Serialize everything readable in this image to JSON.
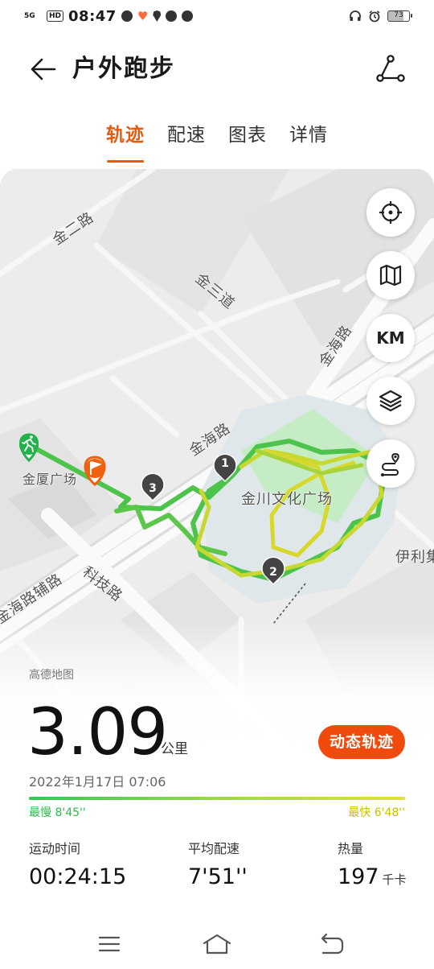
{
  "status_bar": {
    "network": "5G",
    "hd": "HD",
    "time": "08:47",
    "battery": "73"
  },
  "header": {
    "title": "户外跑步"
  },
  "tabs": [
    {
      "label": "轨迹",
      "active": true
    },
    {
      "label": "配速",
      "active": false
    },
    {
      "label": "图表",
      "active": false
    },
    {
      "label": "详情",
      "active": false
    }
  ],
  "map": {
    "roads": {
      "jin_er_road": "金二路",
      "jin_san_dao": "金三道",
      "jin_hai_road_ne": "金海路",
      "jin_hai_road": "金海路",
      "jin_hai_aux": "金海路辅路",
      "keji_road": "科技路",
      "yili": "伊利集"
    },
    "pois": {
      "park": "金川文化广场",
      "building": "金厦广场"
    },
    "markers": [
      "1",
      "2",
      "3"
    ],
    "controls": {
      "km_label": "KM"
    },
    "credit": "高德地图"
  },
  "summary": {
    "distance": "3.09",
    "distance_unit": "公里",
    "replay_label": "动态轨迹",
    "datetime": "2022年1月17日 07:06",
    "pace_slow": "最慢 8'45''",
    "pace_fast": "最快 6'48''"
  },
  "stats": [
    {
      "label": "运动时间",
      "value": "00:24:15",
      "unit": ""
    },
    {
      "label": "平均配速",
      "value": "7'51''",
      "unit": ""
    },
    {
      "label": "热量",
      "value": "197",
      "unit": "千卡"
    }
  ],
  "colors": {
    "accent": "#e8590c",
    "replay_button": "#f04a0c",
    "track_green": "#4cc34a",
    "track_yellow": "#d8d82a",
    "park": "#c6ecc6"
  }
}
